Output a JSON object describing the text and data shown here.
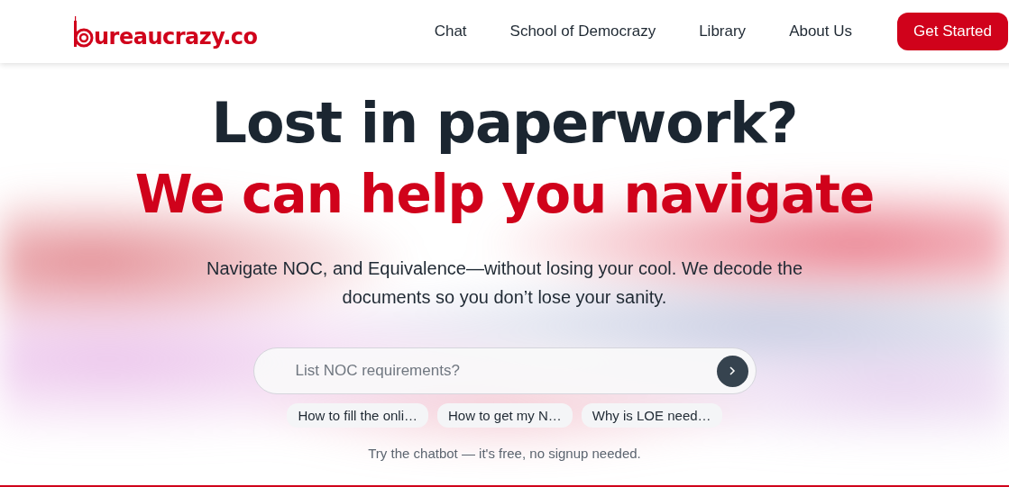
{
  "logo": {
    "text": "ureaucrazy.co"
  },
  "nav": {
    "links": [
      "Chat",
      "School of Democrazy",
      "Library",
      "About Us"
    ],
    "cta": "Get Started"
  },
  "hero": {
    "title": "Lost in paperwork?",
    "subtitle": "We can help you navigate",
    "description": "Navigate NOC, and Equivalence—without losing your cool. We decode the documents so you don’t lose your sanity."
  },
  "chat": {
    "placeholder": "List NOC requirements?",
    "suggestions": [
      "How to fill the onli…",
      "How to get my N…",
      "Why is LOE need…"
    ],
    "note": "Try the chatbot — it's free, no signup needed."
  }
}
